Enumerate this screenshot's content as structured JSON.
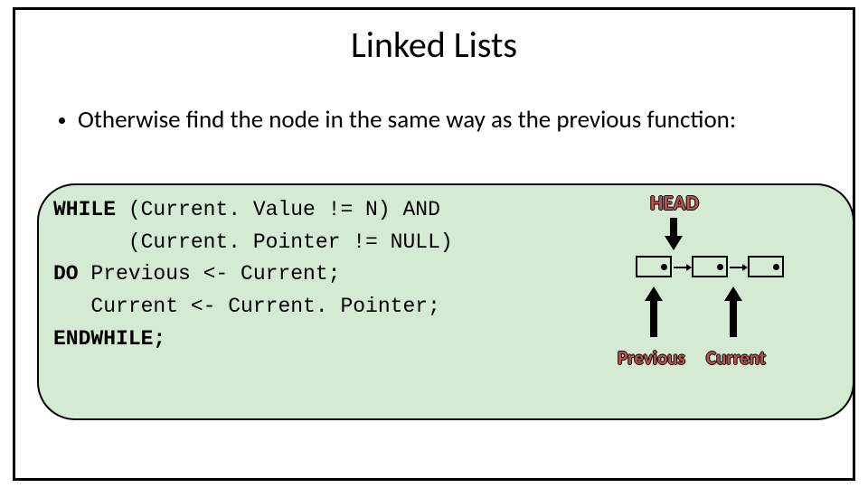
{
  "title": "Linked Lists",
  "bullet": "Otherwise find the node in the same way as the previous function:",
  "code": {
    "kw_while": "WHILE",
    "line1_rest": " (Current. Value != N) AND",
    "line2": "      (Current. Pointer != NULL)",
    "kw_do": "DO",
    "line3_rest": " Previous <- Current;",
    "line4": "   Current <- Current. Pointer;",
    "kw_endwhile": "ENDWHILE;"
  },
  "diagram": {
    "head": "HEAD",
    "previous": "Previous",
    "current": "Current"
  }
}
